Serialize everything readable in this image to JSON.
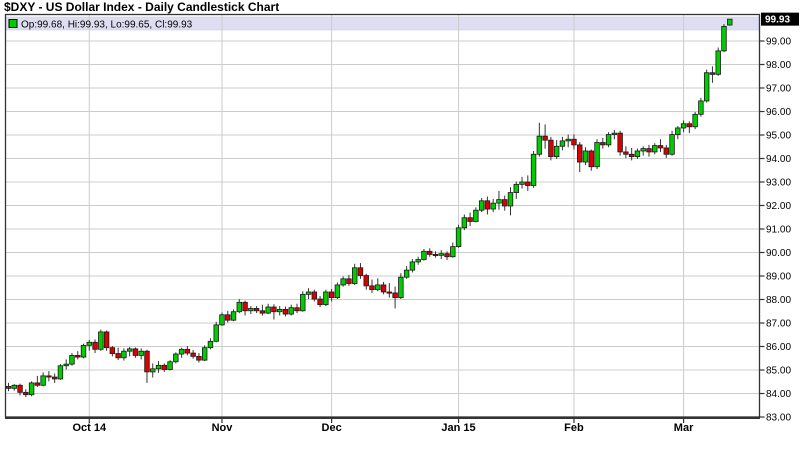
{
  "title": "$DXY - US Dollar Index - Daily Candlestick Chart",
  "legend": {
    "text": "Op:99.68, Hi:99.93, Lo:99.65, Cl:99.93"
  },
  "last_price_tag": "99.93",
  "colors": {
    "up": "#00CC00",
    "down": "#DB0000",
    "body_outline": "#1A1A1A",
    "wick": "#333333",
    "grid": "#CCCCCC",
    "frame": "#333333",
    "legend_bg": "#DEDEF2",
    "legend_border": "#C6C6E4",
    "tag_bg": "#000000",
    "tag_text": "#FFFFFF",
    "background": "#FFFFFF",
    "text": "#000000"
  },
  "y_axis": {
    "labels": [
      "99.00",
      "98.00",
      "97.00",
      "96.00",
      "95.00",
      "94.00",
      "93.00",
      "92.00",
      "91.00",
      "90.00",
      "89.00",
      "88.00",
      "87.00",
      "86.00",
      "85.00",
      "84.00",
      "83.00"
    ],
    "top_value": 99,
    "step": 1
  },
  "x_axis": {
    "ticks": [
      {
        "label": "Oct 14",
        "index": 14
      },
      {
        "label": "Nov",
        "index": 37
      },
      {
        "label": "Dec",
        "index": 56
      },
      {
        "label": "Jan 15",
        "index": 78
      },
      {
        "label": "Feb",
        "index": 98
      },
      {
        "label": "Mar",
        "index": 117
      }
    ]
  },
  "chart_data": {
    "type": "candlestick",
    "symbol": "$DXY",
    "title": "US Dollar Index - Daily Candlestick Chart",
    "timeframe": "Daily",
    "last_ohlc": {
      "open": 99.68,
      "high": 99.93,
      "low": 99.65,
      "close": 99.93
    },
    "ylim": [
      83.0,
      100.15
    ],
    "y_tick_labels": [
      "99.00",
      "98.00",
      "97.00",
      "96.00",
      "95.00",
      "94.00",
      "93.00",
      "92.00",
      "91.00",
      "90.00",
      "89.00",
      "88.00",
      "87.00",
      "86.00",
      "85.00",
      "84.00",
      "83.00"
    ],
    "x_tick_labels": [
      "Oct 14",
      "Nov",
      "Dec",
      "Jan 15",
      "Feb",
      "Mar"
    ],
    "grid": true,
    "legend_position": "top-left",
    "candles": [
      [
        84.3,
        84.45,
        84.1,
        84.22
      ],
      [
        84.22,
        84.4,
        84.12,
        84.35
      ],
      [
        84.35,
        84.42,
        83.92,
        84.05
      ],
      [
        84.05,
        84.18,
        83.85,
        83.95
      ],
      [
        83.95,
        84.52,
        83.88,
        84.45
      ],
      [
        84.45,
        84.75,
        84.28,
        84.35
      ],
      [
        84.35,
        84.9,
        84.3,
        84.75
      ],
      [
        84.75,
        84.95,
        84.52,
        84.7
      ],
      [
        84.7,
        84.85,
        84.45,
        84.62
      ],
      [
        84.62,
        85.25,
        84.58,
        85.18
      ],
      [
        85.18,
        85.45,
        85.02,
        85.25
      ],
      [
        85.25,
        85.72,
        85.18,
        85.62
      ],
      [
        85.62,
        85.8,
        85.45,
        85.55
      ],
      [
        85.55,
        86.12,
        85.5,
        86.05
      ],
      [
        86.05,
        86.28,
        85.82,
        86.18
      ],
      [
        86.18,
        86.3,
        85.72,
        85.88
      ],
      [
        85.88,
        86.72,
        85.82,
        86.62
      ],
      [
        86.62,
        86.68,
        85.82,
        85.95
      ],
      [
        85.95,
        86.02,
        85.58,
        85.7
      ],
      [
        85.7,
        85.95,
        85.42,
        85.52
      ],
      [
        85.52,
        85.92,
        85.4,
        85.8
      ],
      [
        85.8,
        85.98,
        85.58,
        85.9
      ],
      [
        85.9,
        85.96,
        85.52,
        85.62
      ],
      [
        85.62,
        85.92,
        85.45,
        85.8
      ],
      [
        85.8,
        85.86,
        84.45,
        84.92
      ],
      [
        84.92,
        85.28,
        84.68,
        85.05
      ],
      [
        85.05,
        85.38,
        84.88,
        85.2
      ],
      [
        85.2,
        85.28,
        84.92,
        85.02
      ],
      [
        85.02,
        85.42,
        84.98,
        85.35
      ],
      [
        85.35,
        85.75,
        85.28,
        85.68
      ],
      [
        85.68,
        85.95,
        85.52,
        85.88
      ],
      [
        85.88,
        86.02,
        85.62,
        85.72
      ],
      [
        85.72,
        85.85,
        85.48,
        85.58
      ],
      [
        85.58,
        85.72,
        85.32,
        85.42
      ],
      [
        85.42,
        86.05,
        85.38,
        85.95
      ],
      [
        85.95,
        86.35,
        85.88,
        86.22
      ],
      [
        86.22,
        87.05,
        86.18,
        86.92
      ],
      [
        86.92,
        87.45,
        86.88,
        87.35
      ],
      [
        87.35,
        87.52,
        87.02,
        87.12
      ],
      [
        87.12,
        87.58,
        87.08,
        87.48
      ],
      [
        87.48,
        88.02,
        87.42,
        87.88
      ],
      [
        87.88,
        87.95,
        87.32,
        87.52
      ],
      [
        87.52,
        87.72,
        87.38,
        87.62
      ],
      [
        87.62,
        87.72,
        87.42,
        87.52
      ],
      [
        87.52,
        87.78,
        87.32,
        87.42
      ],
      [
        87.42,
        87.82,
        87.38,
        87.68
      ],
      [
        87.68,
        87.8,
        87.15,
        87.48
      ],
      [
        87.48,
        87.72,
        87.32,
        87.58
      ],
      [
        87.58,
        87.7,
        87.28,
        87.38
      ],
      [
        87.38,
        87.78,
        87.32,
        87.65
      ],
      [
        87.65,
        87.82,
        87.42,
        87.52
      ],
      [
        87.52,
        88.35,
        87.48,
        88.22
      ],
      [
        88.22,
        88.48,
        88.02,
        88.32
      ],
      [
        88.32,
        88.42,
        87.92,
        88.02
      ],
      [
        88.02,
        88.15,
        87.68,
        87.78
      ],
      [
        87.78,
        88.42,
        87.72,
        88.32
      ],
      [
        88.32,
        88.45,
        87.92,
        88.08
      ],
      [
        88.08,
        88.72,
        88.02,
        88.62
      ],
      [
        88.62,
        88.98,
        88.55,
        88.88
      ],
      [
        88.88,
        89.05,
        88.58,
        88.68
      ],
      [
        88.68,
        89.52,
        88.62,
        89.35
      ],
      [
        89.35,
        89.55,
        88.88,
        89.02
      ],
      [
        89.02,
        89.1,
        88.42,
        88.58
      ],
      [
        88.58,
        88.85,
        88.28,
        88.42
      ],
      [
        88.42,
        88.9,
        88.35,
        88.62
      ],
      [
        88.62,
        88.75,
        88.22,
        88.32
      ],
      [
        88.32,
        88.7,
        88.08,
        88.28
      ],
      [
        88.28,
        88.55,
        87.62,
        88.08
      ],
      [
        88.08,
        89.12,
        88.02,
        88.95
      ],
      [
        88.95,
        89.42,
        88.88,
        89.25
      ],
      [
        89.25,
        89.72,
        89.15,
        89.6
      ],
      [
        89.6,
        89.82,
        89.48,
        89.7
      ],
      [
        89.7,
        90.15,
        89.65,
        90.05
      ],
      [
        90.05,
        90.18,
        89.82,
        89.92
      ],
      [
        89.92,
        90.05,
        89.78,
        89.88
      ],
      [
        89.88,
        90.1,
        89.72,
        89.95
      ],
      [
        89.95,
        90.05,
        89.68,
        89.82
      ],
      [
        89.82,
        90.42,
        89.78,
        90.25
      ],
      [
        90.25,
        91.18,
        90.2,
        91.05
      ],
      [
        91.05,
        91.62,
        90.95,
        91.48
      ],
      [
        91.48,
        91.7,
        91.12,
        91.32
      ],
      [
        91.32,
        91.92,
        91.28,
        91.8
      ],
      [
        91.8,
        92.32,
        91.72,
        92.2
      ],
      [
        92.2,
        92.38,
        91.62,
        91.85
      ],
      [
        91.85,
        92.28,
        91.72,
        92.1
      ],
      [
        92.1,
        92.62,
        91.82,
        92.25
      ],
      [
        92.25,
        92.42,
        91.78,
        91.98
      ],
      [
        91.98,
        92.78,
        91.58,
        92.55
      ],
      [
        92.55,
        93.02,
        92.28,
        92.9
      ],
      [
        92.9,
        93.22,
        92.72,
        93.0
      ],
      [
        93.0,
        93.28,
        92.62,
        92.85
      ],
      [
        92.85,
        94.32,
        92.75,
        94.18
      ],
      [
        94.18,
        95.52,
        94.08,
        94.95
      ],
      [
        94.95,
        95.45,
        94.42,
        94.78
      ],
      [
        94.78,
        94.92,
        93.92,
        94.08
      ],
      [
        94.08,
        94.78,
        93.98,
        94.52
      ],
      [
        94.52,
        94.92,
        94.35,
        94.75
      ],
      [
        94.75,
        95.02,
        94.48,
        94.82
      ],
      [
        94.82,
        95.02,
        94.38,
        94.58
      ],
      [
        94.58,
        94.7,
        93.42,
        93.85
      ],
      [
        93.85,
        94.48,
        93.72,
        94.32
      ],
      [
        94.32,
        94.38,
        93.48,
        93.65
      ],
      [
        93.65,
        94.82,
        93.55,
        94.68
      ],
      [
        94.68,
        94.88,
        94.42,
        94.58
      ],
      [
        94.58,
        95.12,
        94.48,
        95.02
      ],
      [
        95.02,
        95.22,
        94.82,
        95.08
      ],
      [
        95.08,
        95.18,
        94.12,
        94.28
      ],
      [
        94.28,
        94.52,
        94.02,
        94.18
      ],
      [
        94.18,
        94.45,
        93.92,
        94.08
      ],
      [
        94.08,
        94.42,
        93.98,
        94.32
      ],
      [
        94.32,
        94.52,
        94.12,
        94.42
      ],
      [
        94.42,
        94.58,
        94.08,
        94.28
      ],
      [
        94.28,
        94.65,
        94.18,
        94.55
      ],
      [
        94.55,
        94.82,
        94.28,
        94.45
      ],
      [
        94.45,
        94.58,
        94.02,
        94.18
      ],
      [
        94.18,
        95.18,
        94.12,
        95.02
      ],
      [
        95.02,
        95.38,
        94.82,
        95.3
      ],
      [
        95.3,
        95.62,
        95.12,
        95.48
      ],
      [
        95.48,
        95.58,
        95.08,
        95.35
      ],
      [
        95.35,
        95.98,
        95.25,
        95.88
      ],
      [
        95.88,
        96.58,
        95.78,
        96.45
      ],
      [
        96.45,
        97.78,
        96.38,
        97.65
      ],
      [
        97.65,
        97.92,
        97.22,
        97.58
      ],
      [
        97.58,
        98.72,
        97.52,
        98.58
      ],
      [
        98.58,
        99.72,
        98.52,
        99.62
      ],
      [
        99.68,
        99.93,
        99.65,
        99.93
      ]
    ]
  }
}
